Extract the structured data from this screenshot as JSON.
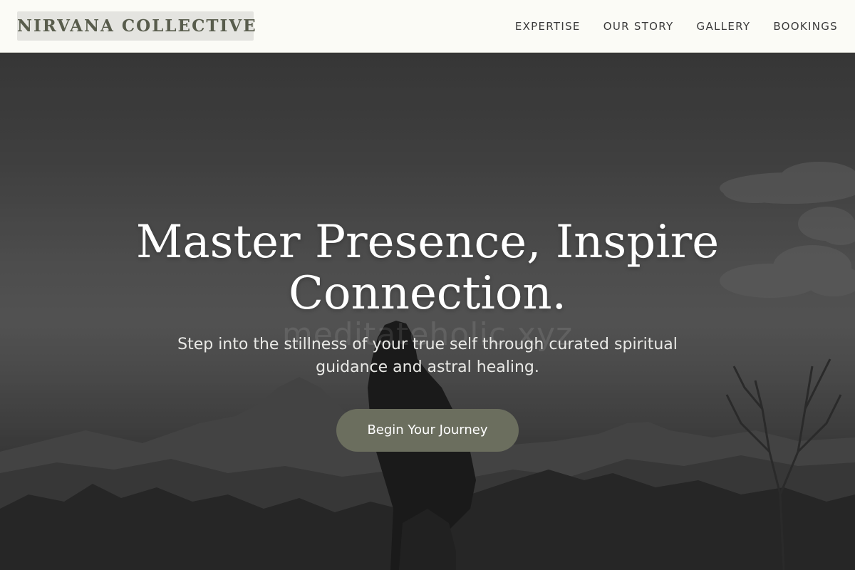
{
  "header": {
    "logo": "NIRVANA COLLECTIVE",
    "nav": [
      {
        "label": "EXPERTISE"
      },
      {
        "label": "OUR STORY"
      },
      {
        "label": "GALLERY"
      },
      {
        "label": "BOOKINGS"
      }
    ]
  },
  "hero": {
    "title": "Master Presence, Inspire Connection.",
    "subtitle": "Step into the stillness of your true self through curated spiritual guidance and astral healing.",
    "cta_label": "Begin Your Journey",
    "watermark": "meditateholic.xyz",
    "image_icon": "meditation-figure-mountains"
  },
  "colors": {
    "header_bg": "#fbfbf6",
    "logo_bg": "#e4e4e0",
    "logo_text": "#585c4c",
    "cta_bg": "#6b6e5e",
    "nav_text": "#3a3a3a"
  }
}
